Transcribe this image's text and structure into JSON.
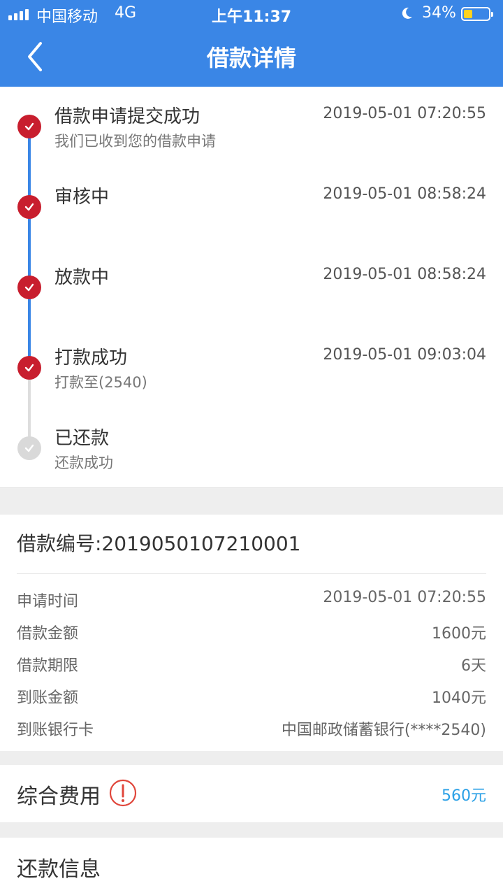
{
  "status_bar": {
    "carrier": "中国移动",
    "network": "4G",
    "time": "上午11:37",
    "battery": "34%",
    "battery_level": 0.34
  },
  "nav": {
    "title": "借款详情"
  },
  "timeline": [
    {
      "title": "借款申请提交成功",
      "time": "2019-05-01 07:20:55",
      "subtitle": "我们已收到您的借款申请",
      "done": true
    },
    {
      "title": "审核中",
      "time": "2019-05-01 08:58:24",
      "subtitle": "",
      "done": true
    },
    {
      "title": "放款中",
      "time": "2019-05-01 08:58:24",
      "subtitle": "",
      "done": true
    },
    {
      "title": "打款成功",
      "time": "2019-05-01 09:03:04",
      "subtitle": "打款至(2540)",
      "done": true
    },
    {
      "title": "已还款",
      "time": "",
      "subtitle": "还款成功",
      "done": false
    }
  ],
  "loan": {
    "number": "借款编号:2019050107210001",
    "rows": [
      {
        "label": "申请时间",
        "value": "2019-05-01 07:20:55"
      },
      {
        "label": "借款金额",
        "value": "1600元"
      },
      {
        "label": "借款期限",
        "value": "6天"
      },
      {
        "label": "到账金额",
        "value": "1040元"
      },
      {
        "label": "到账银行卡",
        "value": "中国邮政储蓄银行(****2540)"
      }
    ]
  },
  "fee": {
    "label": "综合费用",
    "value": "560元"
  },
  "repay": {
    "label": "还款信息"
  },
  "colors": {
    "brand": "#3a86e6",
    "done": "#c81e2e",
    "pending": "#d9d9d9",
    "fee_value": "#2aa0e6",
    "warning": "#e0463b"
  }
}
